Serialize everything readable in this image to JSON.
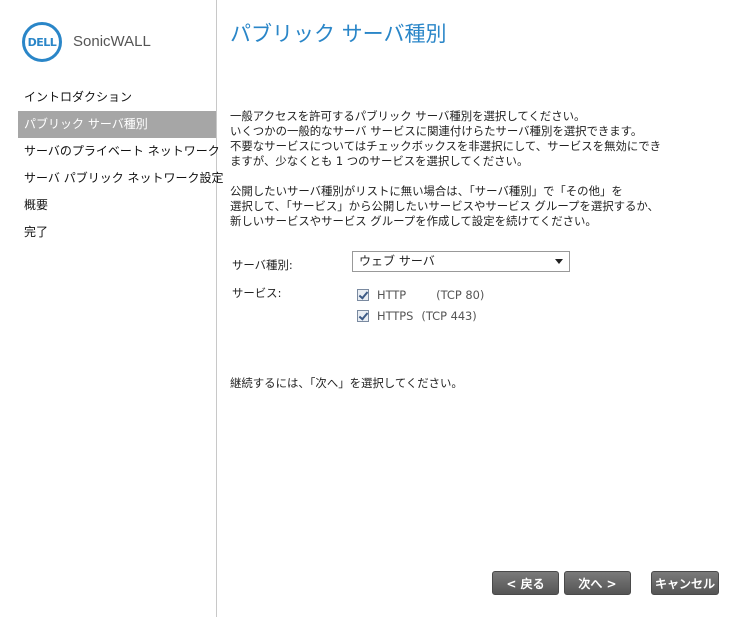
{
  "brand": {
    "logo_text": "DELL",
    "product": "SonicWALL",
    "accent_color": "#2a86c8"
  },
  "sidebar": {
    "items": [
      {
        "label": "イントロダクション",
        "active": false
      },
      {
        "label": "パブリック サーバ種別",
        "active": true
      },
      {
        "label": "サーバのプライベート ネットワーク",
        "active": false
      },
      {
        "label": "サーバ パブリック ネットワーク設定",
        "active": false
      },
      {
        "label": "概要",
        "active": false
      },
      {
        "label": "完了",
        "active": false
      }
    ]
  },
  "main": {
    "title": "パブリック サーバ種別",
    "para1": [
      "一般アクセスを許可するパブリック サーバ種別を選択してください。",
      "いくつかの一般的なサーバ サービスに関連付けらたサーバ種別を選択できます。",
      "不要なサービスについてはチェックボックスを非選択にして、サービスを無効にでき",
      "ますが、少なくとも 1 つのサービスを選択してください。"
    ],
    "para2": [
      "公開したいサーバ種別がリストに無い場合は、「サーバ種別」で「その他」を",
      "選択して、「サービス」から公開したいサービスやサービス グループを選択するか、",
      "新しいサービスやサービス グループを作成して設定を続けてください。"
    ],
    "server_type_label": "サーバ種別:",
    "server_type_value": "ウェブ サーバ",
    "service_label": "サービス:",
    "services": [
      {
        "name": "HTTP",
        "port": "(TCP 80)",
        "checked": true
      },
      {
        "name": "HTTPS",
        "port": "(TCP 443)",
        "checked": true
      }
    ],
    "continue_text": "継続するには、「次へ」を選択してください。"
  },
  "buttons": {
    "back": "< 戻る",
    "next": "次へ >",
    "cancel": "キャンセル"
  }
}
